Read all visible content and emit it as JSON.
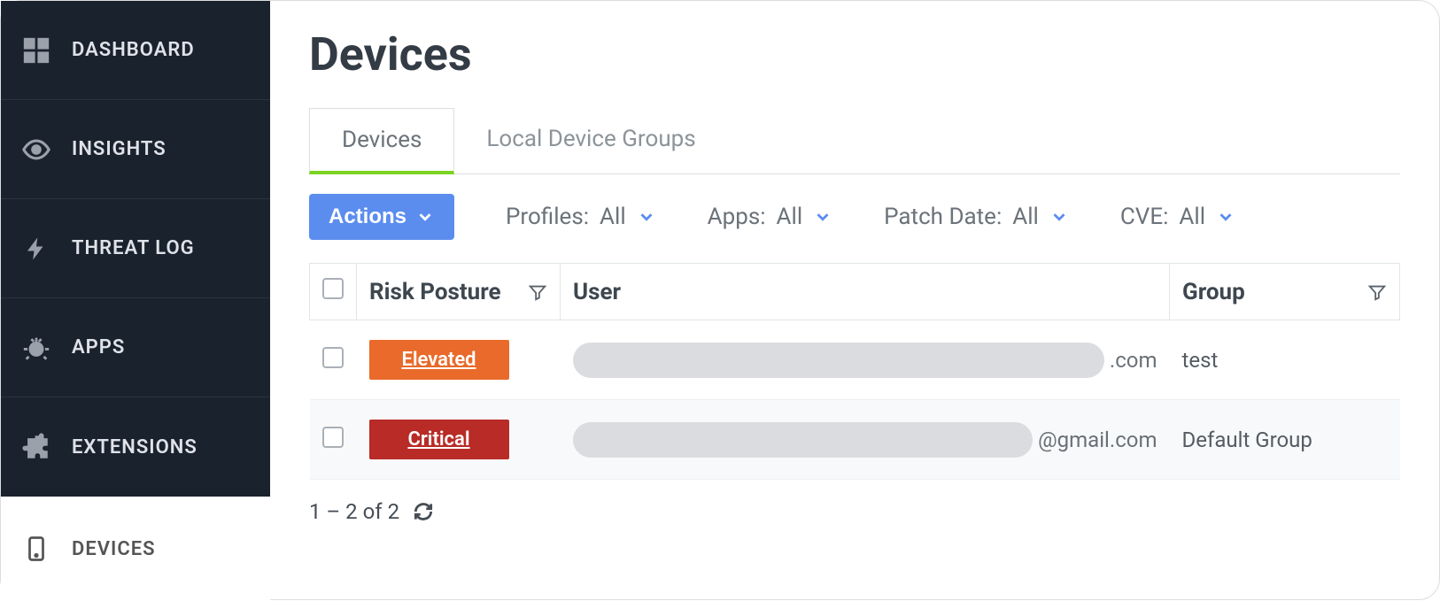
{
  "sidebar": {
    "items": [
      {
        "label": "DASHBOARD",
        "icon": "dashboard"
      },
      {
        "label": "INSIGHTS",
        "icon": "eye"
      },
      {
        "label": "THREAT LOG",
        "icon": "bolt"
      },
      {
        "label": "APPS",
        "icon": "bug"
      },
      {
        "label": "EXTENSIONS",
        "icon": "puzzle"
      }
    ],
    "active_item": {
      "label": "DEVICES",
      "icon": "device"
    }
  },
  "page": {
    "title": "Devices"
  },
  "tabs": [
    {
      "label": "Devices",
      "active": true
    },
    {
      "label": "Local Device Groups",
      "active": false
    }
  ],
  "filters": {
    "actions_label": "Actions",
    "items": [
      {
        "label": "Profiles:",
        "value": "All"
      },
      {
        "label": "Apps:",
        "value": "All"
      },
      {
        "label": "Patch Date:",
        "value": "All"
      },
      {
        "label": "CVE:",
        "value": "All"
      }
    ]
  },
  "table": {
    "columns": {
      "risk": "Risk Posture",
      "user": "User",
      "group": "Group"
    },
    "rows": [
      {
        "risk_label": "Elevated",
        "risk_color": "elevated",
        "user_suffix": ".com",
        "group": "test"
      },
      {
        "risk_label": "Critical",
        "risk_color": "critical",
        "user_suffix": "@gmail.com",
        "group": "Default Group"
      }
    ]
  },
  "pagination": {
    "text": "1 – 2 of 2"
  }
}
